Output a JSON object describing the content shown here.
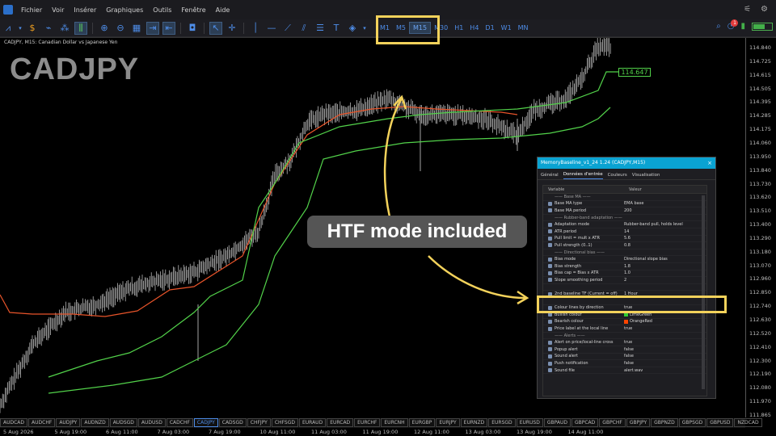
{
  "menubar": {
    "items": [
      "Fichier",
      "Voir",
      "Insérer",
      "Graphiques",
      "Outils",
      "Fenêtre",
      "Aide"
    ]
  },
  "toolbar": {
    "timeframes": [
      "M1",
      "M5",
      "M15",
      "M30",
      "H1",
      "H4",
      "D1",
      "W1",
      "MN"
    ],
    "active_timeframe": "M15",
    "notification_count": "1"
  },
  "chart": {
    "header": "CADJPY, M15:  Canadian Dollar vs Japanese Yen",
    "symbol_watermark": "CADJPY",
    "current_price_tag": "114.647",
    "price_labels": [
      "114.840",
      "114.725",
      "114.615",
      "114.505",
      "114.395",
      "114.285",
      "114.175",
      "114.060",
      "113.950",
      "113.840",
      "113.730",
      "113.620",
      "113.510",
      "113.400",
      "113.290",
      "113.180",
      "113.070",
      "112.960",
      "112.850",
      "112.740",
      "112.630",
      "112.520",
      "112.410",
      "112.300",
      "112.190",
      "112.080",
      "111.970",
      "111.865"
    ],
    "time_labels": [
      "5 Aug 2026",
      "5 Aug 19:00",
      "6 Aug 11:00",
      "7 Aug 03:00",
      "7 Aug 19:00",
      "10 Aug 11:00",
      "11 Aug 03:00",
      "11 Aug 19:00",
      "12 Aug 11:00",
      "13 Aug 03:00",
      "13 Aug 19:00",
      "14 Aug 11:00"
    ],
    "symbol_tabs": [
      "AUDCAD",
      "AUDCHF",
      "AUDJPY",
      "AUDNZD",
      "AUDSGD",
      "AUDUSD",
      "CADCHF",
      "CADJPY",
      "CADSGD",
      "CHFJPY",
      "CHFSGD",
      "EURAUD",
      "EURCAD",
      "EURCHF",
      "EURCNH",
      "EURGBP",
      "EURJPY",
      "EURNZD",
      "EURSGD",
      "EURUSD",
      "GBPAUD",
      "GBPCAD",
      "GBPCHF",
      "GBPJPY",
      "GBPNZD",
      "GBPSGD",
      "GBPUSD",
      "NZDCAD"
    ],
    "active_symbol": "CADJPY"
  },
  "callout": {
    "text": "HTF mode included"
  },
  "dialog": {
    "title": "MemoryBaseline_v1_24 1.24 (CADJPY,M15)",
    "tabs": [
      "Général",
      "Données d'entrée",
      "Couleurs",
      "Visualisation"
    ],
    "active_tab": "Données d'entrée",
    "col_variable": "Variable",
    "col_value": "Valeur",
    "rows": [
      {
        "name": "—— Base MA ——",
        "value": "",
        "section": true
      },
      {
        "name": "Base MA type",
        "value": "EMA base"
      },
      {
        "name": "Base MA period",
        "value": "200"
      },
      {
        "name": "—— Rubber-band adaptation ——",
        "value": "",
        "section": true
      },
      {
        "name": "Adaptation mode",
        "value": "Rubber-band pull, holds level"
      },
      {
        "name": "ATR period",
        "value": "14"
      },
      {
        "name": "Pull limit = mult x ATR",
        "value": "5.6"
      },
      {
        "name": "Pull strength (0..1)",
        "value": "0.8"
      },
      {
        "name": "—— Directional bias ——",
        "value": "",
        "section": true
      },
      {
        "name": "Bias mode",
        "value": "Directional slope bias"
      },
      {
        "name": "Bias strength",
        "value": "1.8"
      },
      {
        "name": "Bias cap = Bias x ATR",
        "value": "1.0"
      },
      {
        "name": "Slope smoothing period",
        "value": "2"
      },
      {
        "name": "",
        "value": "",
        "section": true
      },
      {
        "name": "2nd baseline TF (Current = off)",
        "value": "1 Hour"
      },
      {
        "name": "",
        "value": "",
        "section": true
      },
      {
        "name": "Colour lines by direction",
        "value": "true"
      },
      {
        "name": "Bullish colour",
        "value": "LimeGreen",
        "swatch": "#32cd32"
      },
      {
        "name": "Bearish colour",
        "value": "OrangeRed",
        "swatch": "#ff4500"
      },
      {
        "name": "Price label at the local line",
        "value": "true"
      },
      {
        "name": "—— Alerts ——",
        "value": "",
        "section": true
      },
      {
        "name": "Alert on price/local-line cross",
        "value": "true"
      },
      {
        "name": "Popup alert",
        "value": "false"
      },
      {
        "name": "Sound alert",
        "value": "false"
      },
      {
        "name": "Push notification",
        "value": "false"
      },
      {
        "name": "Sound file",
        "value": "alert.wav"
      }
    ]
  },
  "colors": {
    "baseline_green": "#52d24a",
    "baseline_orange": "#e8542a",
    "highlight": "#f3d25b",
    "accent_blue": "#4e8de8"
  }
}
